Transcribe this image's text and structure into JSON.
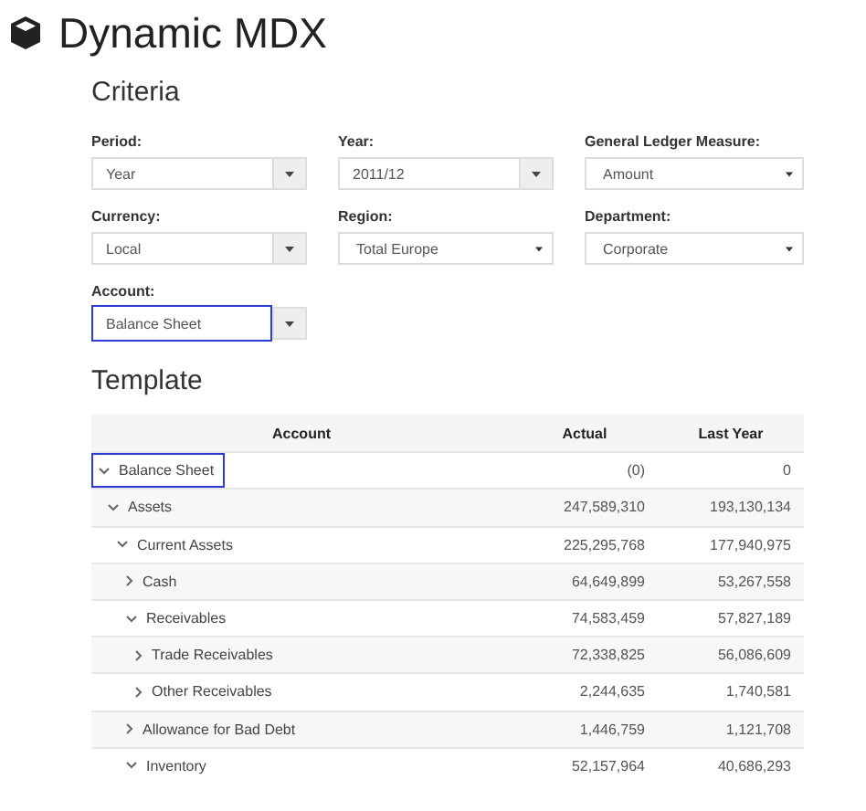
{
  "title": "Dynamic MDX",
  "criteria": {
    "heading": "Criteria",
    "fields": [
      {
        "label": "Period:",
        "value": "Year",
        "kind": "combo",
        "highlighted": false
      },
      {
        "label": "Year:",
        "value": "2011/12",
        "kind": "combo",
        "highlighted": false
      },
      {
        "label": "General Ledger Measure:",
        "value": "Amount",
        "kind": "select",
        "highlighted": false
      },
      {
        "label": "Currency:",
        "value": "Local",
        "kind": "combo",
        "highlighted": false
      },
      {
        "label": "Region:",
        "value": "Total Europe",
        "kind": "select",
        "highlighted": false
      },
      {
        "label": "Department:",
        "value": "Corporate",
        "kind": "select",
        "highlighted": false
      },
      {
        "label": "Account:",
        "value": "Balance Sheet",
        "kind": "combo",
        "highlighted": true
      }
    ]
  },
  "template": {
    "heading": "Template",
    "columns": [
      "Account",
      "Actual",
      "Last Year"
    ],
    "rows": [
      {
        "account": "Balance Sheet",
        "actual": "(0)",
        "last_year": "0",
        "expanded": true,
        "highlighted": true,
        "children": [
          {
            "account": "Assets",
            "actual": "247,589,310",
            "last_year": "193,130,134",
            "expanded": true,
            "highlighted": false,
            "children": [
              {
                "account": "Current Assets",
                "actual": "225,295,768",
                "last_year": "177,940,975",
                "expanded": true,
                "highlighted": false,
                "children": [
                  {
                    "account": "Cash",
                    "actual": "64,649,899",
                    "last_year": "53,267,558",
                    "expanded": false,
                    "highlighted": false
                  },
                  {
                    "account": "Receivables",
                    "actual": "74,583,459",
                    "last_year": "57,827,189",
                    "expanded": true,
                    "highlighted": false,
                    "children": [
                      {
                        "account": "Trade Receivables",
                        "actual": "72,338,825",
                        "last_year": "56,086,609",
                        "expanded": false,
                        "highlighted": false
                      },
                      {
                        "account": "Other Receivables",
                        "actual": "2,244,635",
                        "last_year": "1,740,581",
                        "expanded": false,
                        "highlighted": false
                      }
                    ]
                  },
                  {
                    "account": "Allowance for Bad Debt",
                    "actual": "1,446,759",
                    "last_year": "1,121,708",
                    "expanded": false,
                    "highlighted": false
                  },
                  {
                    "account": "Inventory",
                    "actual": "52,157,964",
                    "last_year": "40,686,293",
                    "expanded": true,
                    "highlighted": false
                  }
                ]
              }
            ]
          }
        ]
      }
    ]
  }
}
